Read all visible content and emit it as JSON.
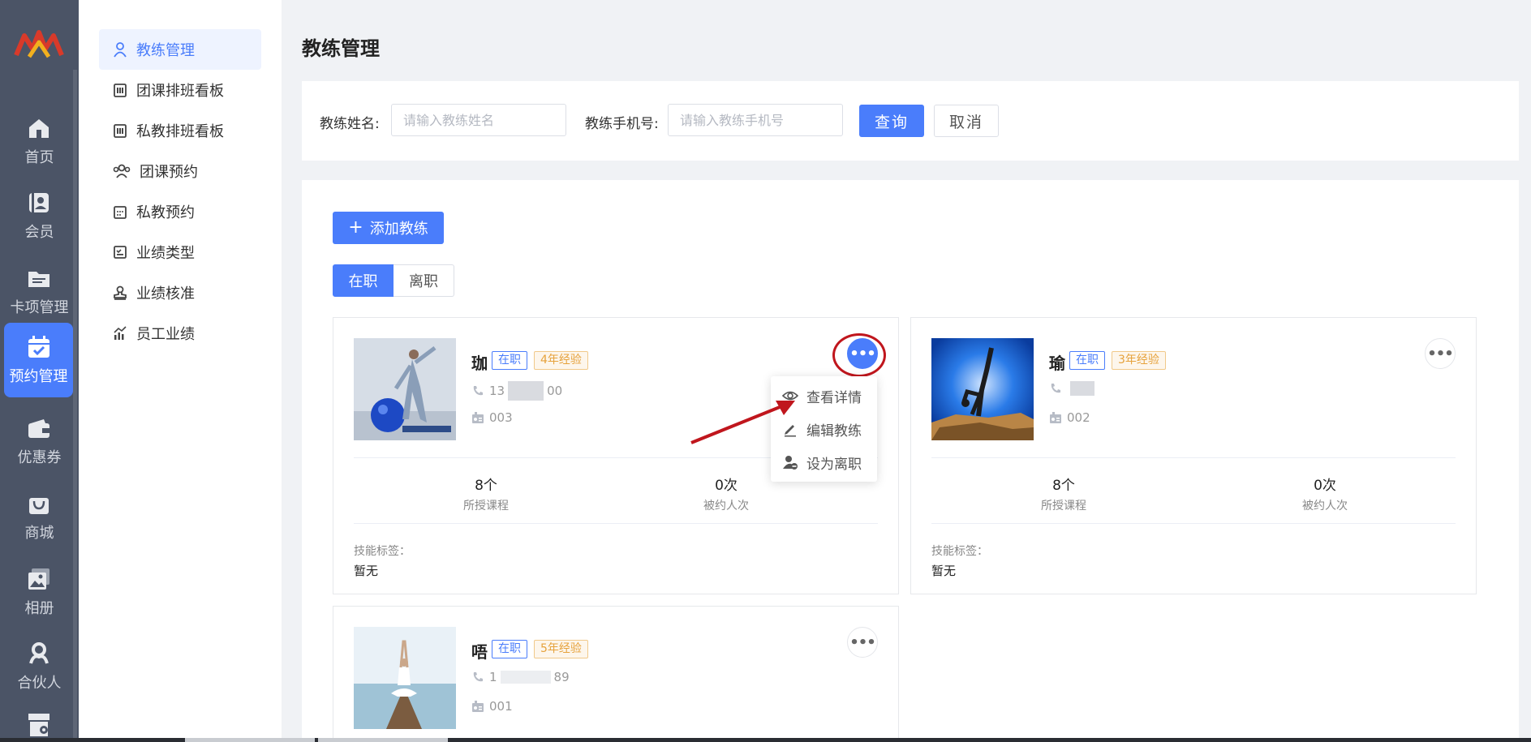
{
  "rail": {
    "items": [
      {
        "label": "首页",
        "icon": "home-icon"
      },
      {
        "label": "会员",
        "icon": "member-icon"
      },
      {
        "label": "卡项管理",
        "icon": "card-folder-icon"
      },
      {
        "label": "预约管理",
        "icon": "calendar-check-icon",
        "active": true
      },
      {
        "label": "优惠券",
        "icon": "wallet-icon"
      },
      {
        "label": "商城",
        "icon": "shopping-bag-icon"
      },
      {
        "label": "相册",
        "icon": "album-icon"
      },
      {
        "label": "合伙人",
        "icon": "partner-icon"
      }
    ]
  },
  "submenu": {
    "items": [
      {
        "label": "教练管理",
        "icon": "user-icon",
        "active": true
      },
      {
        "label": "团课排班看板",
        "icon": "board-icon"
      },
      {
        "label": "私教排班看板",
        "icon": "board-icon"
      },
      {
        "label": "团课预约",
        "icon": "group-icon"
      },
      {
        "label": "私教预约",
        "icon": "calendar-icon"
      },
      {
        "label": "业绩类型",
        "icon": "checklist-icon"
      },
      {
        "label": "业绩核准",
        "icon": "stamp-icon"
      },
      {
        "label": "员工业绩",
        "icon": "chart-icon"
      }
    ]
  },
  "page": {
    "title": "教练管理"
  },
  "search": {
    "name_label": "教练姓名:",
    "name_placeholder": "请输入教练姓名",
    "phone_label": "教练手机号:",
    "phone_placeholder": "请输入教练手机号",
    "query_label": "查询",
    "cancel_label": "取消"
  },
  "list": {
    "add_label": "添加教练",
    "tabs": [
      {
        "label": "在职",
        "active": true
      },
      {
        "label": "离职"
      }
    ]
  },
  "coaches": [
    {
      "name": "珈",
      "status": "在职",
      "experience": "4年经验",
      "phone_start": "13",
      "phone_end": "00",
      "number": "003",
      "courses_value": "8个",
      "courses_label": "所授课程",
      "booked_value": "0次",
      "booked_label": "被约人次",
      "skill_label": "技能标签：",
      "skill_value": "暂无"
    },
    {
      "name": "瑜",
      "status": "在职",
      "experience": "3年经验",
      "phone_start": "",
      "phone_end": "",
      "number": "002",
      "courses_value": "8个",
      "courses_label": "所授课程",
      "booked_value": "0次",
      "booked_label": "被约人次",
      "skill_label": "技能标签：",
      "skill_value": "暂无"
    },
    {
      "name": "唔",
      "status": "在职",
      "experience": "5年经验",
      "phone_start": "1",
      "phone_end": "89",
      "number": "001"
    }
  ],
  "dropdown": {
    "items": [
      {
        "label": "查看详情",
        "icon": "eye-icon"
      },
      {
        "label": "编辑教练",
        "icon": "pencil-icon"
      },
      {
        "label": "设为离职",
        "icon": "user-minus-icon"
      }
    ]
  },
  "colors": {
    "primary": "#4a7dfb",
    "rail": "#4b5466",
    "highlight_ring": "#c0161d",
    "experience_tag": "#e6a23c"
  }
}
